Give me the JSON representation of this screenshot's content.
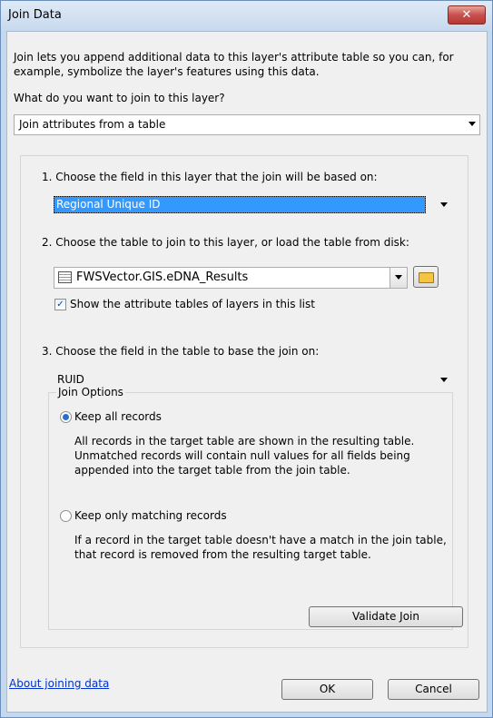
{
  "window": {
    "title": "Join Data",
    "close_label": "✕"
  },
  "intro": "Join lets you append additional data to this layer's attribute table so you can, for example, symbolize the layer's features using this data.",
  "question": "What do you want to join to this layer?",
  "join_type": {
    "value": "Join attributes from a table"
  },
  "step1": {
    "label": "1.  Choose the field in this layer that the join will be based on:",
    "value": "Regional Unique ID"
  },
  "step2": {
    "label": "2.  Choose the table to join to this layer, or load the table from disk:",
    "value": "FWSVector.GIS.eDNA_Results",
    "checkbox_label": "Show the attribute tables of layers in this list",
    "checkbox_checked": true
  },
  "step3": {
    "label": "3.  Choose the field in the table to base the join on:",
    "value": "RUID"
  },
  "join_options": {
    "legend": "Join Options",
    "keep_all": {
      "label": "Keep all records",
      "selected": true,
      "description": "All records in the target table are shown in the resulting table. Unmatched records will contain null values for all fields being appended into the target table from the join table."
    },
    "keep_matching": {
      "label": "Keep only matching records",
      "selected": false,
      "description": "If a record in the target table doesn't have a match in the join table, that record is removed from the resulting target table."
    }
  },
  "buttons": {
    "validate": "Validate Join",
    "ok": "OK",
    "cancel": "Cancel"
  },
  "help_link": "About joining data",
  "icons": {
    "table": "table-icon",
    "folder": "open-folder-icon",
    "dropdown": "chevron-down-icon"
  }
}
